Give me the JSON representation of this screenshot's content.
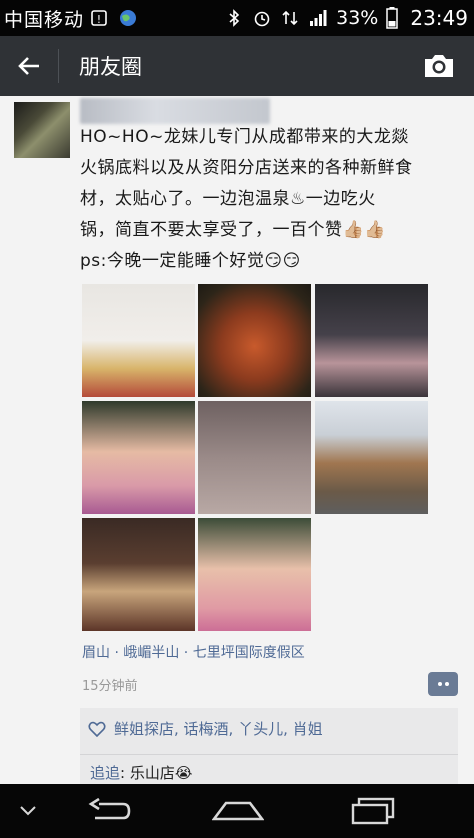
{
  "status_bar": {
    "carrier": "中国移动",
    "battery": "33%",
    "time": "23:49"
  },
  "action_bar": {
    "title": "朋友圈",
    "back_icon": "arrow-left-icon",
    "camera_icon": "camera-icon"
  },
  "post": {
    "text_lines": [
      "HO~HO~龙妹儿专门从成都带来的大龙燚",
      "火锅底料以及从资阳分店送来的各种新鲜食",
      "材，太贴心了。一边泡温泉♨一边吃火",
      "锅，简直不要太享受了，一百个赞👍🏼👍🏼",
      "ps:今晚一定能睡个好觉😏😏"
    ],
    "photo_count": 8,
    "location": "眉山 · 峨嵋半山 · 七里坪国际度假区",
    "time_ago": "15分钟前",
    "likes": "鲜姐探店, 话梅酒, 丫头儿, 肖姐",
    "comment": {
      "author": "追追",
      "text": "乐山店😭"
    }
  },
  "colors": {
    "status_bar": "#050505",
    "action_bar": "#2f3236",
    "link_blue": "#4f6a95",
    "background": "#f3f3f3",
    "likes_box": "#e9e9ea"
  }
}
